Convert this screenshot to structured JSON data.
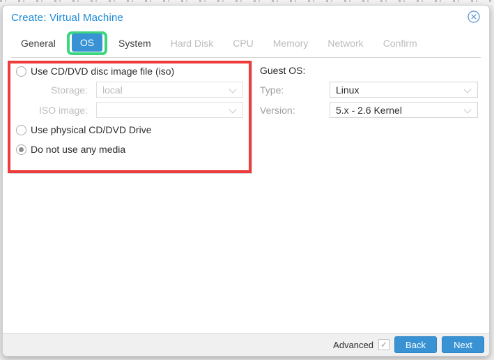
{
  "window": {
    "title": "Create: Virtual Machine"
  },
  "tabs": [
    {
      "label": "General",
      "state": "enabled"
    },
    {
      "label": "OS",
      "state": "active"
    },
    {
      "label": "System",
      "state": "enabled"
    },
    {
      "label": "Hard Disk",
      "state": "disabled"
    },
    {
      "label": "CPU",
      "state": "disabled"
    },
    {
      "label": "Memory",
      "state": "disabled"
    },
    {
      "label": "Network",
      "state": "disabled"
    },
    {
      "label": "Confirm",
      "state": "disabled"
    }
  ],
  "media": {
    "options": [
      {
        "label": "Use CD/DVD disc image file (iso)",
        "selected": false
      },
      {
        "label": "Use physical CD/DVD Drive",
        "selected": false
      },
      {
        "label": "Do not use any media",
        "selected": true
      }
    ],
    "storage": {
      "label": "Storage:",
      "value": "local",
      "disabled": true
    },
    "iso_image": {
      "label": "ISO image:",
      "value": "",
      "disabled": true
    }
  },
  "guest_os": {
    "heading": "Guest OS:",
    "type": {
      "label": "Type:",
      "value": "Linux"
    },
    "version": {
      "label": "Version:",
      "value": "5.x - 2.6 Kernel"
    }
  },
  "footer": {
    "advanced_label": "Advanced",
    "advanced_checked": true,
    "check_glyph": "✓",
    "back_label": "Back",
    "next_label": "Next"
  },
  "annotations": {
    "green_box_color": "#3bd67e",
    "red_box_color": "#ee3b3b"
  },
  "colors": {
    "title_blue": "#1989d9",
    "active_tab_bg": "#3892d4",
    "button_bg": "#3892d4"
  }
}
